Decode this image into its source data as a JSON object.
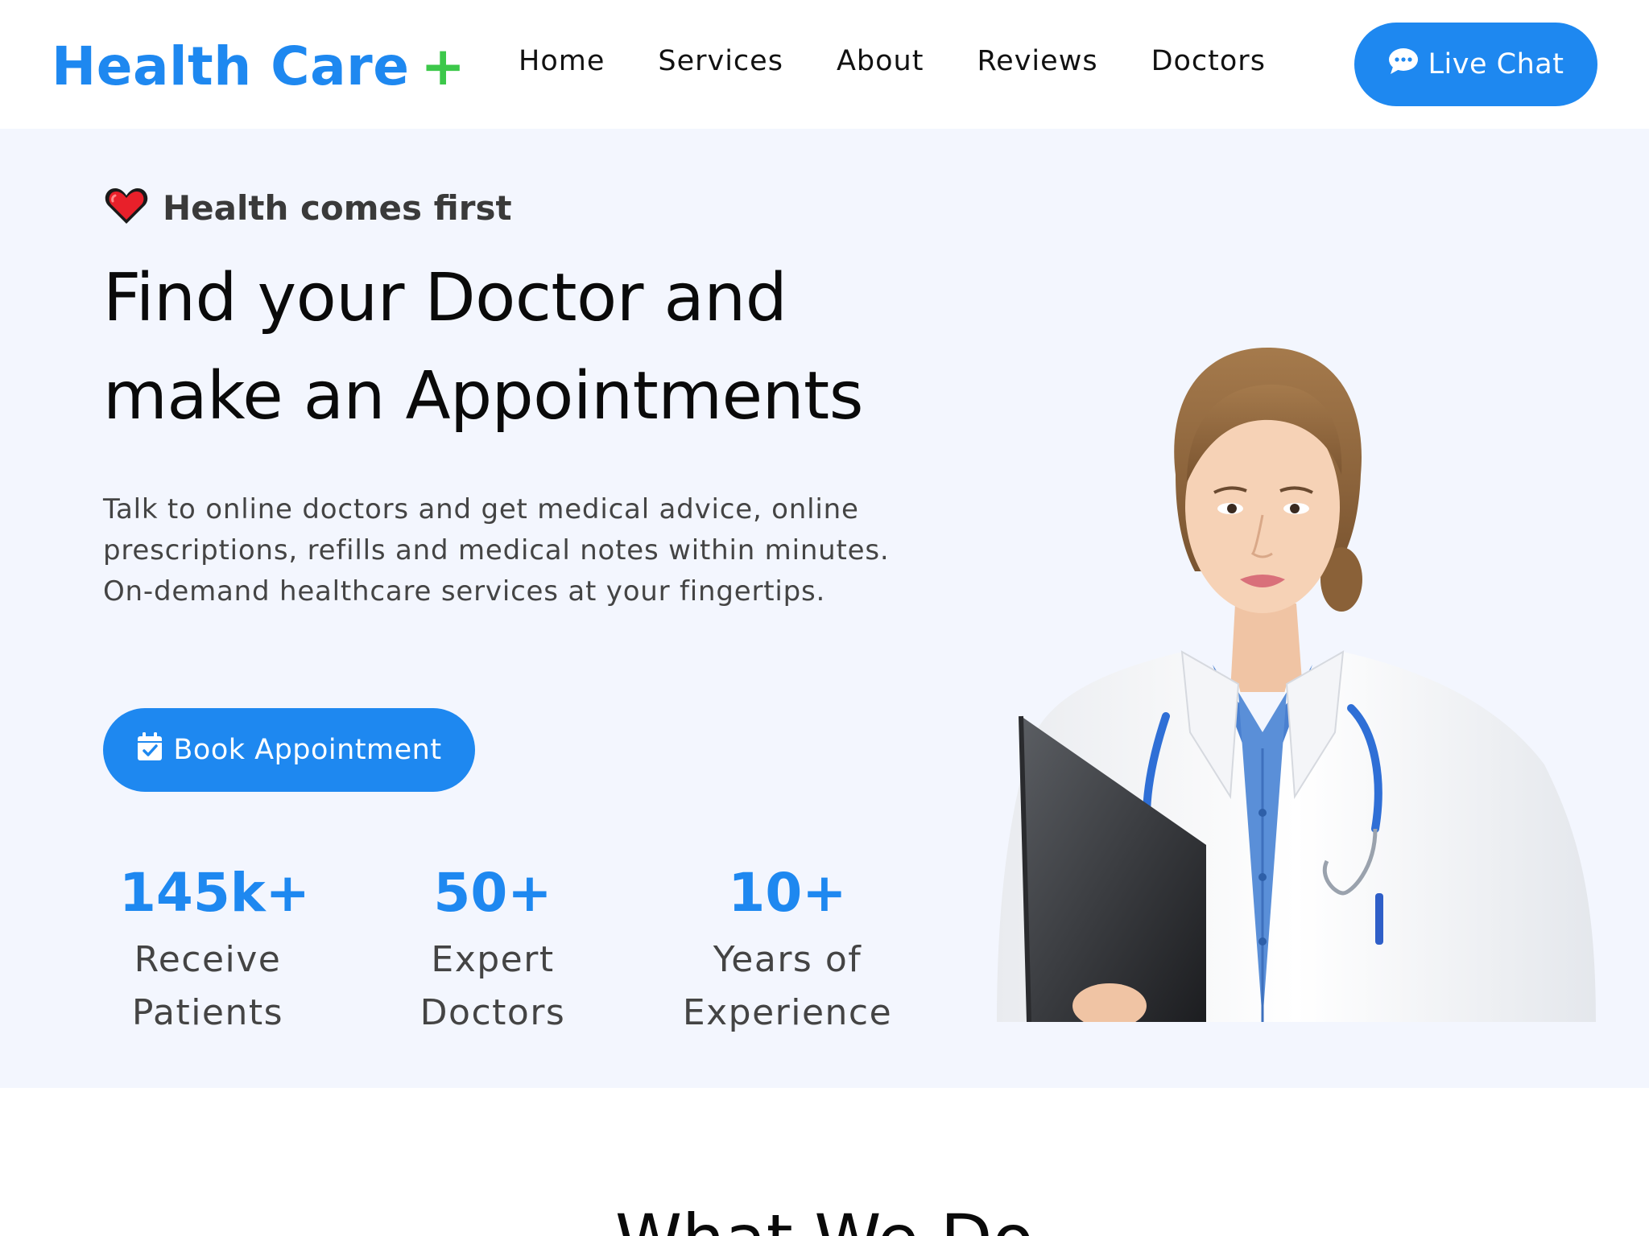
{
  "nav": {
    "brand_name": "Health Care",
    "brand_symbol": "+",
    "links": [
      "Home",
      "Services",
      "About",
      "Reviews",
      "Doctors"
    ],
    "cta_label": "Live Chat",
    "cta_icon": "chat-bubble-icon"
  },
  "hero": {
    "tagline_icon": "heart-icon",
    "tagline": "Health comes first",
    "headline_line1": "Find your Doctor and",
    "headline_line2": "make an Appointments",
    "description": "Talk to online doctors and get medical advice, online prescriptions, refills and medical notes within minutes. On-demand healthcare services at your fingertips.",
    "book_label": "Book Appointment",
    "book_icon": "calendar-check-icon",
    "stats": [
      {
        "value": "145k+",
        "label_line1": "Receive",
        "label_line2": "Patients"
      },
      {
        "value": "50+",
        "label_line1": "Expert",
        "label_line2": "Doctors"
      },
      {
        "value": "10+",
        "label_line1": "Years of",
        "label_line2": "Experience"
      }
    ]
  },
  "section": {
    "title": "What We Do"
  },
  "colors": {
    "brand_blue": "#1e88f0",
    "brand_green": "#3cc84a",
    "hero_bg": "#f3f6fe",
    "heart_red": "#e8202a"
  }
}
